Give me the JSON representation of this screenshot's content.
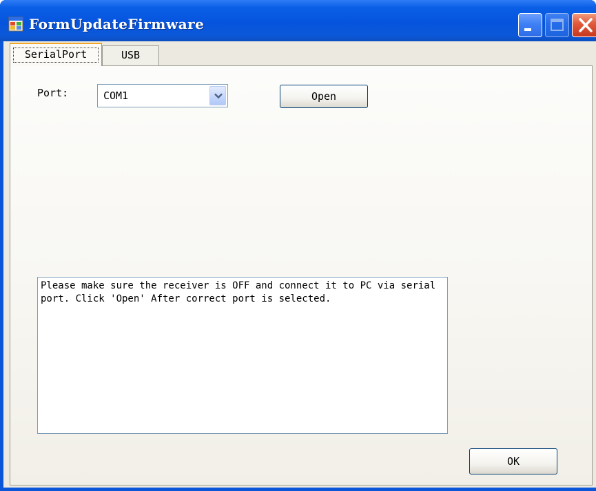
{
  "window": {
    "title": "FormUpdateFirmware",
    "icon": "app-window-icon",
    "controls": [
      "minimize-icon",
      "maximize-icon",
      "close-icon"
    ]
  },
  "tabs": [
    {
      "label": "SerialPort",
      "selected": true
    },
    {
      "label": "USB",
      "selected": false
    }
  ],
  "serial": {
    "port_label": "Port:",
    "port_value": "COM1",
    "open_label": "Open",
    "message": "Please make sure the receiver is OFF and connect it to PC via serial port. Click 'Open' After correct port is selected."
  },
  "footer": {
    "ok_label": "OK"
  },
  "colors": {
    "titlebar": "#0654dd",
    "client": "#eceae0",
    "tab_highlight": "#f0a72b",
    "button_border": "#003c74",
    "input_border": "#7f9db9"
  }
}
